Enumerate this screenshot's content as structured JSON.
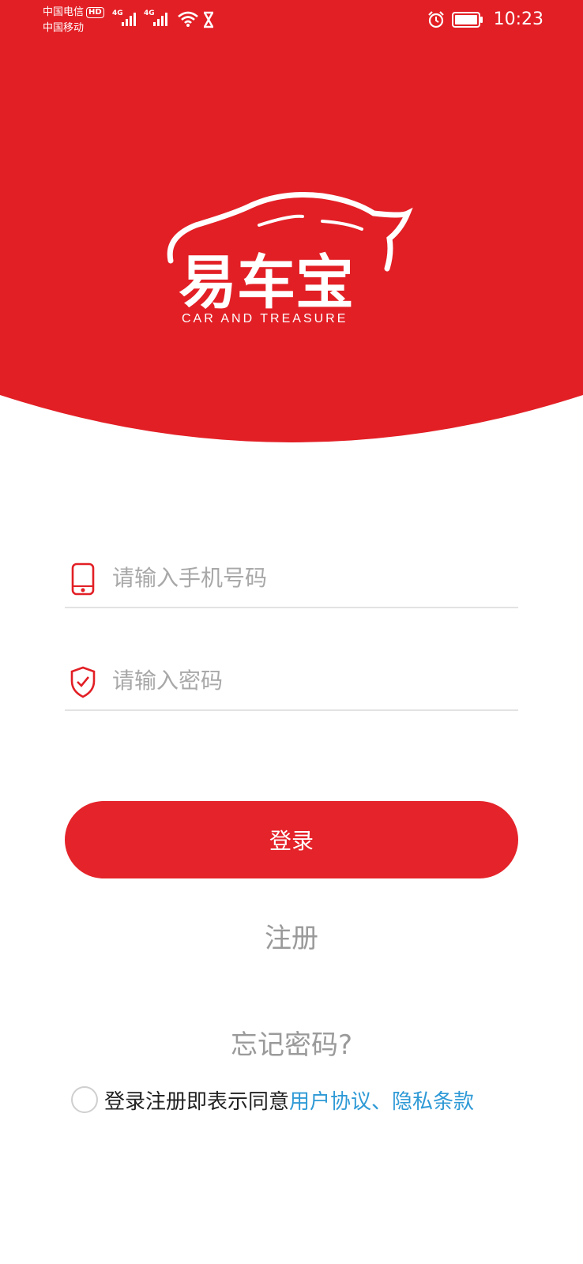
{
  "status_bar": {
    "carrier_1": "中国电信",
    "carrier_badge": "HD",
    "carrier_2": "中国移动",
    "network_1": "4G",
    "network_2": "4G",
    "time": "10:23"
  },
  "logo": {
    "title": "易车宝",
    "subtitle": "CAR AND TREASURE"
  },
  "form": {
    "phone_placeholder": "请输入手机号码",
    "phone_value": "",
    "password_placeholder": "请输入密码",
    "password_value": "",
    "login_label": "登录",
    "register_label": "注册",
    "forgot_label": "忘记密码?"
  },
  "agreement": {
    "checked": false,
    "prefix": "登录注册即表示同意",
    "links": "用户协议、隐私条款"
  },
  "colors": {
    "brand_red": "#e21f25",
    "link_blue": "#2f9ad6"
  }
}
